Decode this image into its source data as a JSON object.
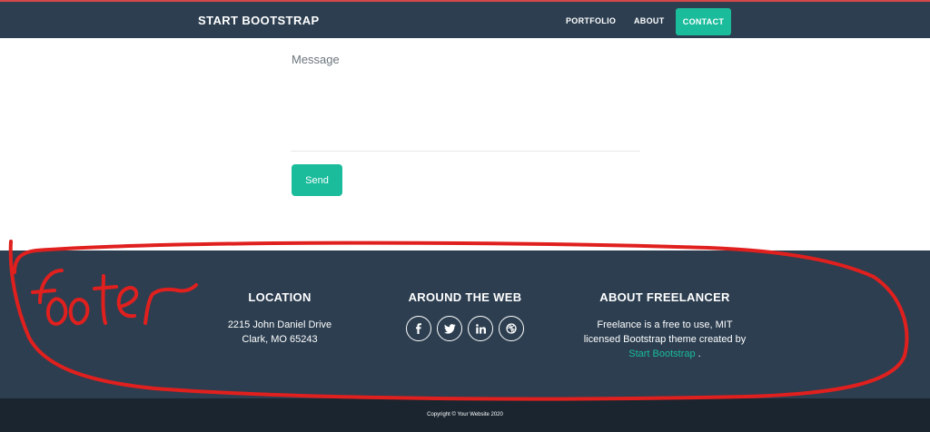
{
  "navbar": {
    "brand": "START BOOTSTRAP",
    "links": [
      {
        "label": "PORTFOLIO"
      },
      {
        "label": "ABOUT"
      },
      {
        "label": "CONTACT",
        "active": true
      }
    ]
  },
  "contact_form": {
    "message_placeholder": "Message",
    "send_label": "Send"
  },
  "footer": {
    "location": {
      "title": "LOCATION",
      "line1": "2215 John Daniel Drive",
      "line2": "Clark, MO 65243"
    },
    "around_the_web": {
      "title": "AROUND THE WEB",
      "icons": [
        "facebook-icon",
        "twitter-icon",
        "linkedin-icon",
        "dribbble-icon"
      ]
    },
    "about": {
      "title": "ABOUT FREELANCER",
      "line1": "Freelance is a free to use, MIT",
      "line2": "licensed Bootstrap theme created by",
      "link_text": "Start Bootstrap",
      "suffix": " ."
    }
  },
  "copyright": "Copyright © Your Website 2020",
  "annotation": {
    "text": "footer",
    "color": "#e0201e"
  },
  "colors": {
    "navbar_bg": "#2c3e50",
    "accent": "#1abc9c",
    "copyright_bg": "#1a252f"
  }
}
